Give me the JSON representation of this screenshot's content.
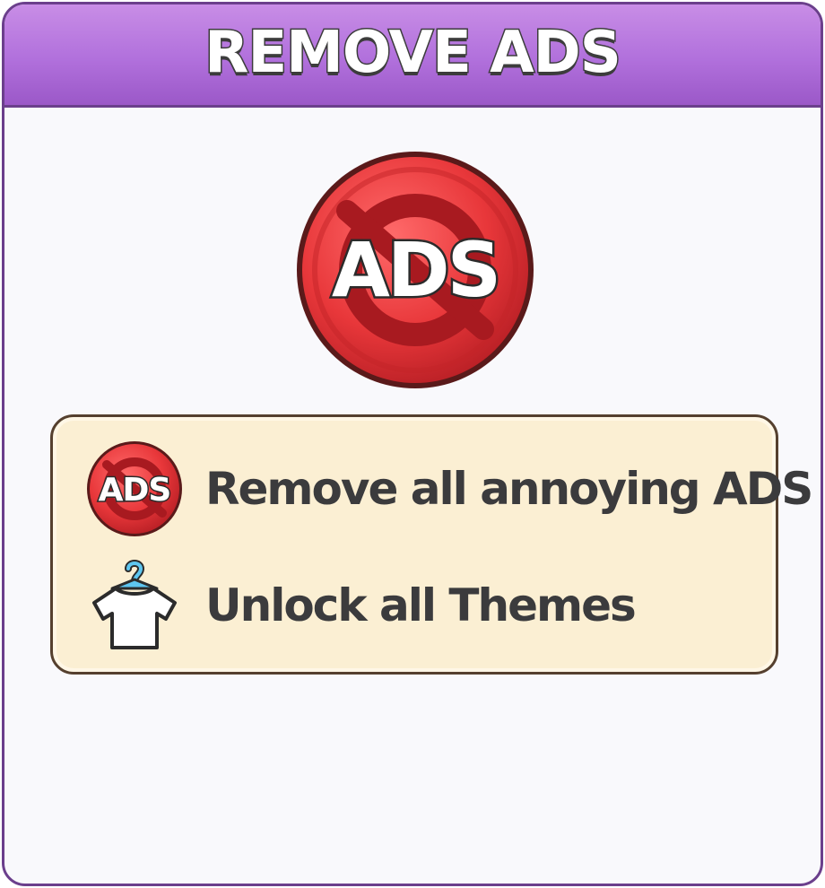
{
  "dialog": {
    "title": "REMOVE ADS",
    "hero_icon": "no-ads-icon",
    "hero_badge_text": "ADS"
  },
  "features": [
    {
      "icon": "no-ads-icon",
      "badge_text": "ADS",
      "label": "Remove all annoying ADS"
    },
    {
      "icon": "tshirt-hanger-icon",
      "label": "Unlock all Themes"
    }
  ],
  "colors": {
    "header_top": "#c88de6",
    "header_bottom": "#9b58c8",
    "border": "#6b3f8c",
    "badge_red": "#e8373a",
    "feature_bg": "#fbefd3",
    "feature_text": "#3b3b3d",
    "hanger_blue": "#5ec6f0"
  }
}
